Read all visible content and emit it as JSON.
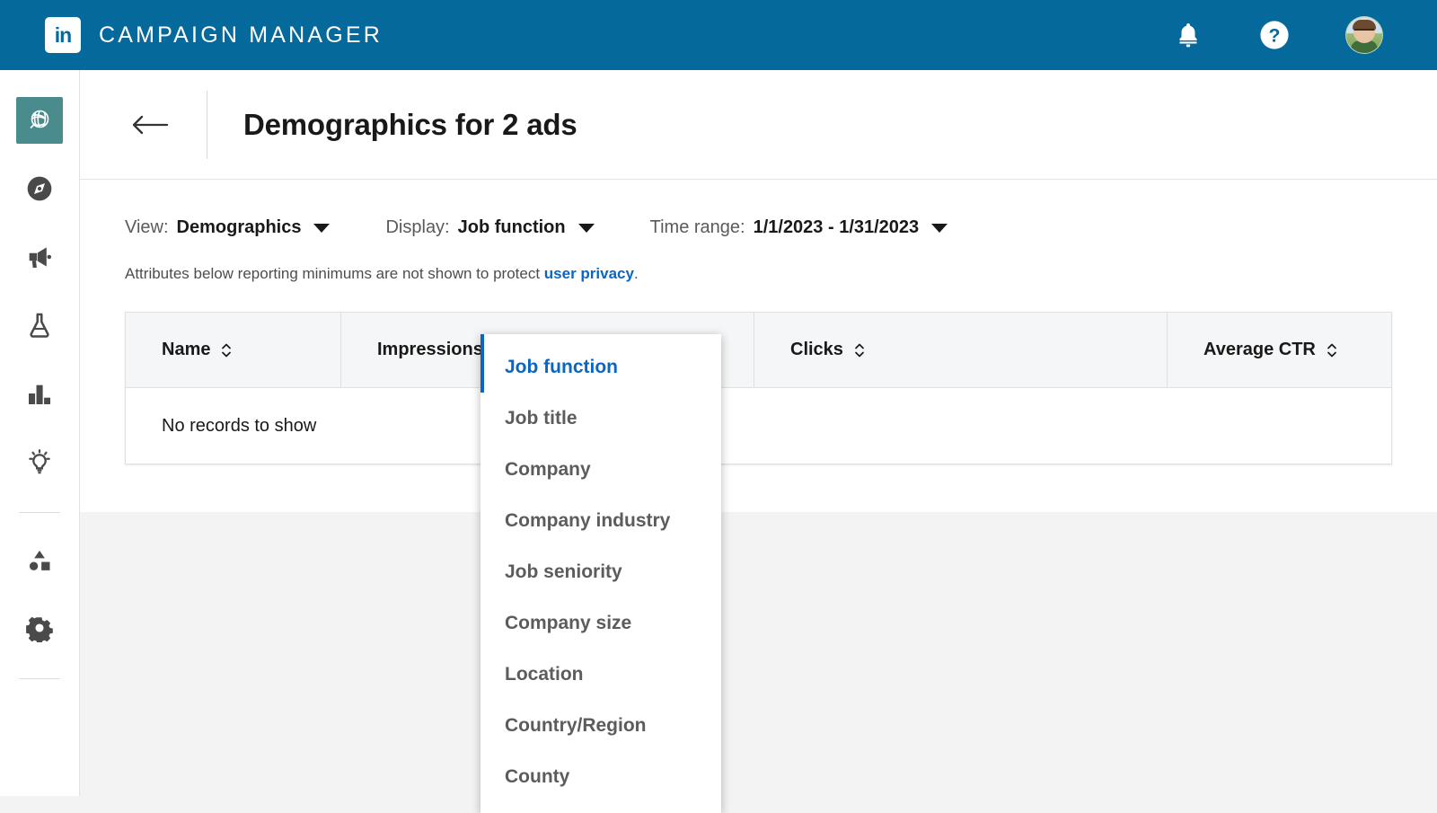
{
  "header": {
    "logo_icon": "linkedin-logo-icon",
    "logo_text": "in",
    "title": "CAMPAIGN MANAGER",
    "brand_color": "#05699c",
    "actions": [
      {
        "name": "notifications-icon",
        "label": "Notifications"
      },
      {
        "name": "help-icon",
        "label": "Help"
      },
      {
        "name": "avatar",
        "label": "Account"
      }
    ]
  },
  "sidebar": {
    "active_color": "#4a8c8d",
    "items": [
      {
        "name": "sidebar-item-account",
        "icon": "globe-sphere-icon",
        "active": true
      },
      {
        "name": "sidebar-item-plan",
        "icon": "compass-icon",
        "active": false
      },
      {
        "name": "sidebar-item-advertise",
        "icon": "megaphone-icon",
        "active": false
      },
      {
        "name": "sidebar-item-test",
        "icon": "flask-icon",
        "active": false
      },
      {
        "name": "sidebar-item-analyze",
        "icon": "bar-chart-icon",
        "active": false
      },
      {
        "name": "sidebar-item-insights",
        "icon": "lightbulb-icon",
        "active": false
      },
      {
        "name": "sidebar-item-assets",
        "icon": "shapes-icon",
        "active": false
      },
      {
        "name": "sidebar-item-settings",
        "icon": "gear-icon",
        "active": false
      }
    ]
  },
  "page": {
    "back_icon": "back-arrow-icon",
    "title": "Demographics for 2 ads"
  },
  "filters": [
    {
      "name": "view-filter",
      "label": "View:",
      "value": "Demographics"
    },
    {
      "name": "display-filter",
      "label": "Display:",
      "value": "Job function"
    },
    {
      "name": "time-range-filter",
      "label": "Time range:",
      "value": "1/1/2023 - 1/31/2023"
    }
  ],
  "note": {
    "text_before": "Attributes below reporting minimums are not shown to protect ",
    "link_text": "user privacy",
    "text_after": "."
  },
  "table": {
    "columns": [
      {
        "name": "column-name",
        "label": "Name",
        "sortable": true
      },
      {
        "name": "column-impressions",
        "label": "Impressions",
        "sortable": true
      },
      {
        "name": "column-clicks",
        "label": "Clicks",
        "sortable": true
      },
      {
        "name": "column-average-ctr",
        "label": "Average CTR",
        "sortable": true
      }
    ],
    "rows": [],
    "empty_message": "No records to show"
  },
  "dropdown": {
    "open": true,
    "selected": "Job function",
    "accent_color": "#0a66c2",
    "items": [
      {
        "name": "dropdown-item-job-function",
        "label": "Job function"
      },
      {
        "name": "dropdown-item-job-title",
        "label": "Job title"
      },
      {
        "name": "dropdown-item-company",
        "label": "Company"
      },
      {
        "name": "dropdown-item-company-industry",
        "label": "Company industry"
      },
      {
        "name": "dropdown-item-job-seniority",
        "label": "Job seniority"
      },
      {
        "name": "dropdown-item-company-size",
        "label": "Company size"
      },
      {
        "name": "dropdown-item-location",
        "label": "Location"
      },
      {
        "name": "dropdown-item-country-region",
        "label": "Country/Region"
      },
      {
        "name": "dropdown-item-county",
        "label": "County"
      }
    ]
  }
}
